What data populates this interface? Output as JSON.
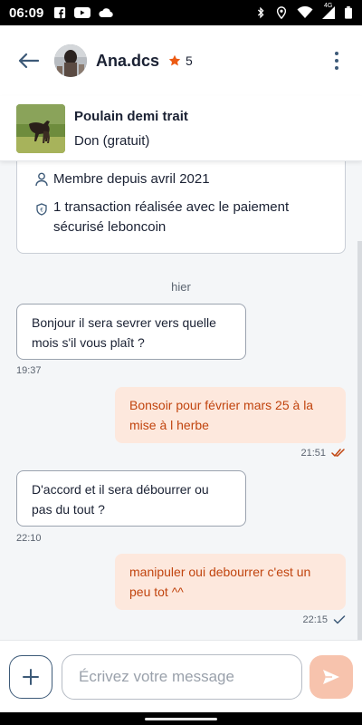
{
  "status_bar": {
    "time": "06:09",
    "icons_left": [
      "facebook-icon",
      "youtube-icon",
      "cloud-icon"
    ],
    "icons_right": [
      "bluetooth-icon",
      "location-icon",
      "wifi-icon",
      "signal-4g-icon",
      "battery-icon"
    ],
    "network_label": "4G"
  },
  "header": {
    "user_name": "Ana.dcs",
    "rating": "5",
    "accent_color": "#ec5a13"
  },
  "listing": {
    "title": "Poulain demi trait",
    "price": "Don (gratuit)"
  },
  "info_card": {
    "member_since": "Membre depuis avril 2021",
    "transaction_line1": "1 transaction réalisée avec le paiement",
    "transaction_line2": "sécurisé leboncoin"
  },
  "date_separator": "hier",
  "messages": [
    {
      "direction": "in",
      "line1": "Bonjour il sera sevrer vers quelle",
      "line2": "mois s'il vous plaît ?",
      "time": "19:37"
    },
    {
      "direction": "out",
      "line1": "Bonsoir pour février mars 25 à la",
      "line2": "mise à l herbe",
      "time": "21:51",
      "status": "read"
    },
    {
      "direction": "in",
      "line1": "D'accord et il sera débourrer ou",
      "line2": "pas du tout ?",
      "time": "22:10"
    },
    {
      "direction": "out",
      "line1": "manipuler oui debourrer c'est un",
      "line2": "peu tot ^^",
      "time": "22:15",
      "status": "delivered"
    }
  ],
  "composer": {
    "placeholder": "Écrivez votre message",
    "value": ""
  },
  "colors": {
    "outgoing_bg": "#fde8dd",
    "outgoing_text": "#c1440e",
    "nav_blue": "#3d5a78",
    "send_btn": "#f7c3ad"
  }
}
